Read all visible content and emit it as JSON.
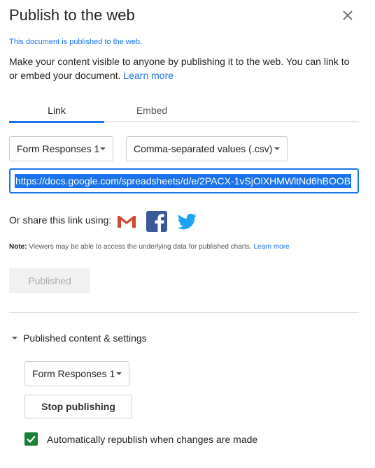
{
  "dialog": {
    "title": "Publish to the web",
    "status": "This document is published to the web.",
    "description": "Make your content visible to anyone by publishing it to the web. You can link to or embed your document.",
    "learn_more": "Learn more"
  },
  "tabs": [
    {
      "label": "Link",
      "active": true
    },
    {
      "label": "Embed",
      "active": false
    }
  ],
  "link_options": {
    "sheet_select": "Form Responses 1",
    "format_select": "Comma-separated values (.csv)",
    "url": "https://docs.google.com/spreadsheets/d/e/2PACX-1vSjOlXHMWltNd6hBOOB"
  },
  "share": {
    "label": "Or share this link using:",
    "icons": [
      "gmail-icon",
      "facebook-icon",
      "twitter-icon"
    ]
  },
  "note": {
    "label": "Note:",
    "text": "Viewers may be able to access the underlying data for published charts.",
    "learn_more": "Learn more"
  },
  "published_button": "Published",
  "settings": {
    "toggle_label": "Published content & settings",
    "sheet_select": "Form Responses 1",
    "stop_button": "Stop publishing",
    "auto_republish_label": "Automatically republish when changes are made",
    "auto_republish_checked": true
  },
  "colors": {
    "accent": "#1a73e8",
    "checkbox": "#188038"
  }
}
